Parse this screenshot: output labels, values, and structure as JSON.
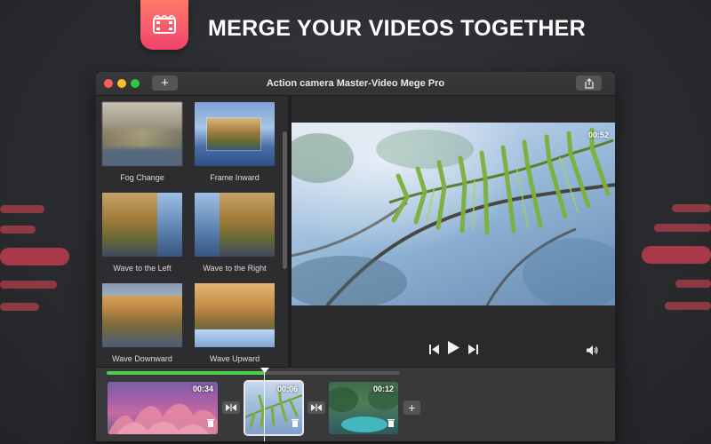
{
  "headline": "MERGE YOUR VIDEOS TOGETHER",
  "window": {
    "title": "Action camera Master-Video Mege Pro",
    "add_label": "+"
  },
  "transitions": [
    {
      "label": "Fog Change"
    },
    {
      "label": "Frame Inward"
    },
    {
      "label": "Wave to the Left"
    },
    {
      "label": "Wave to the Right"
    },
    {
      "label": "Wave Downward"
    },
    {
      "label": "Wave Upward"
    }
  ],
  "preview": {
    "timecode": "00:52"
  },
  "timeline": {
    "progress_fraction": 0.54,
    "clips": [
      {
        "duration": "00:34",
        "selected": false
      },
      {
        "duration": "00:06",
        "selected": true
      },
      {
        "duration": "00:12",
        "selected": false
      }
    ],
    "add_label": "+"
  },
  "colors": {
    "accent_green": "#4ad04a",
    "badge_gradient_top": "#ff7a6b",
    "badge_gradient_bottom": "#f2436c",
    "stripe_red": "#b83a48",
    "close": "#ff5f57",
    "minimize": "#febc2e",
    "zoom": "#28c840"
  },
  "icons": {
    "app": "film-clip-icon",
    "share": "share-icon",
    "previous": "skip-back-icon",
    "play": "play-icon",
    "next": "skip-forward-icon",
    "volume": "volume-icon",
    "transition": "bowtie-transition-icon",
    "delete": "trash-icon"
  }
}
